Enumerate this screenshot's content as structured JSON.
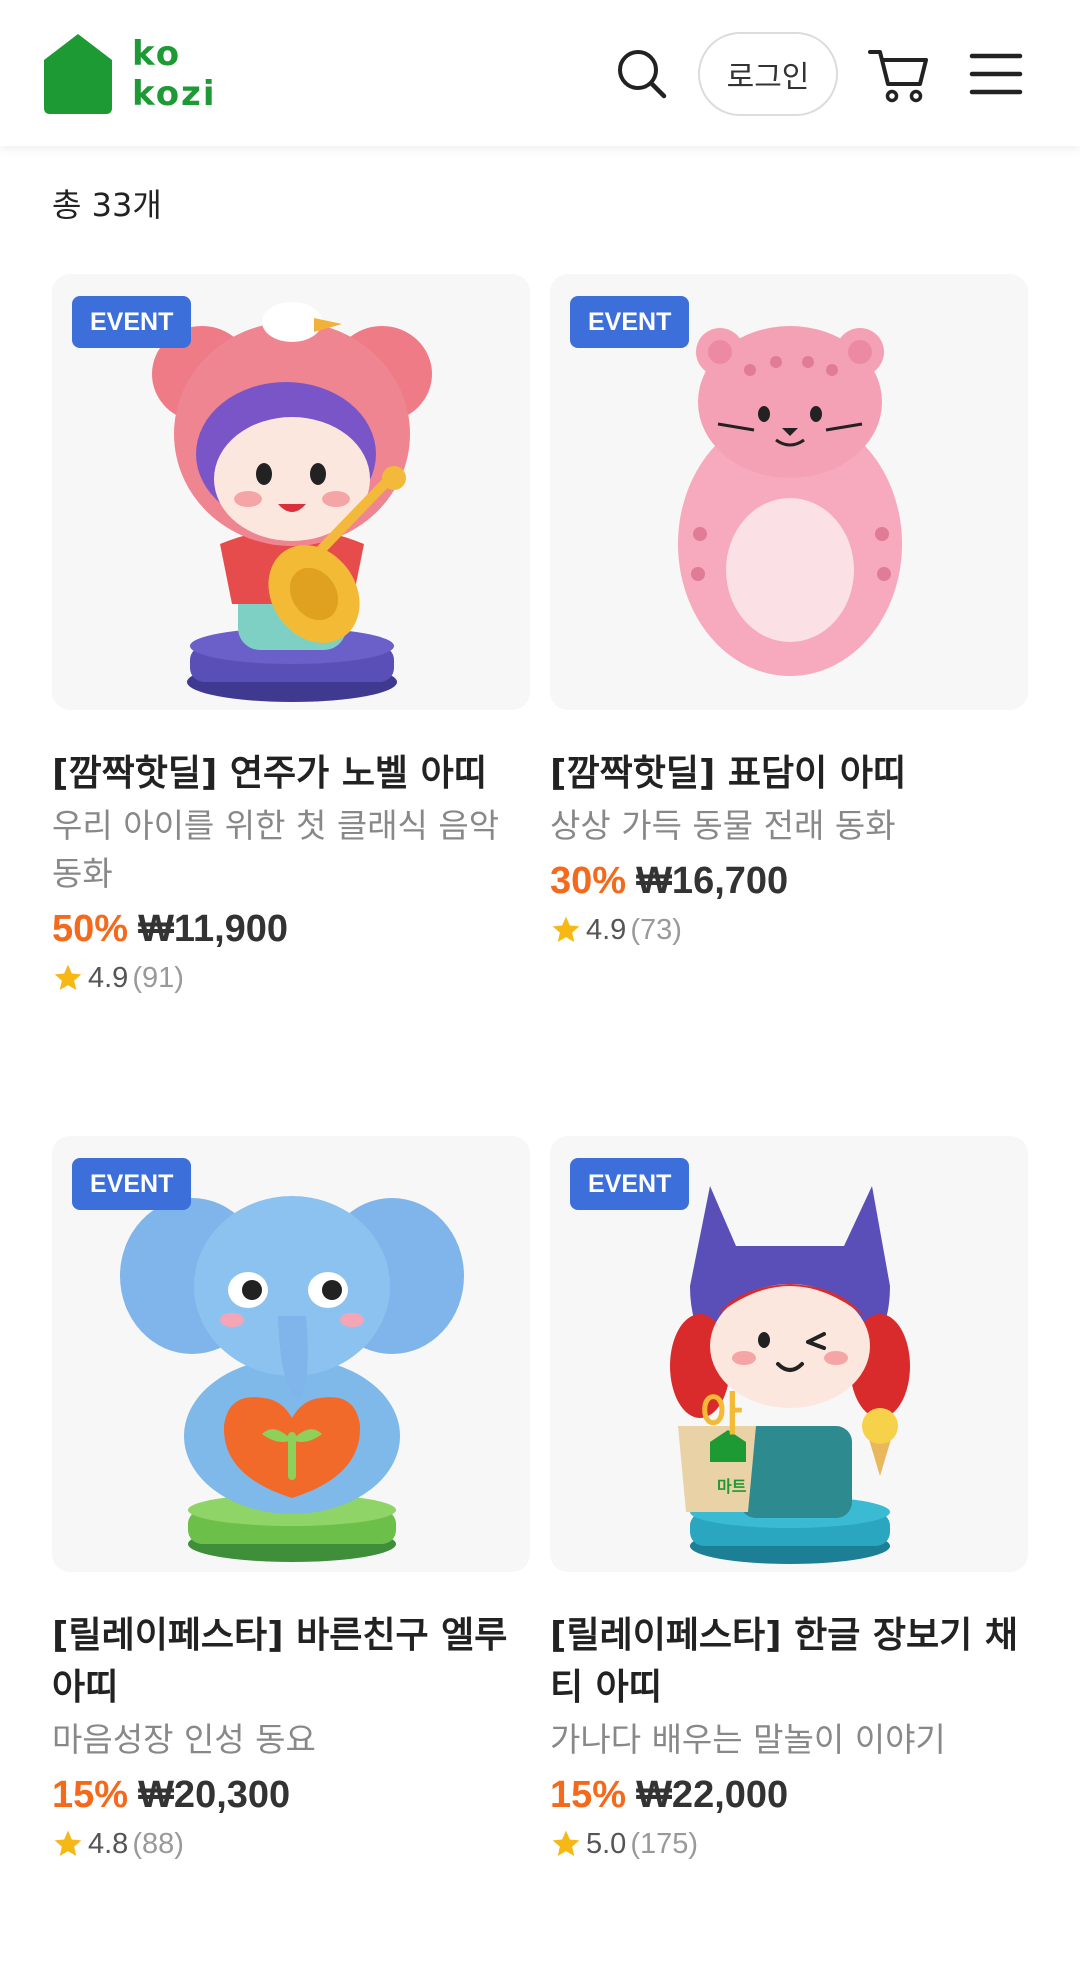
{
  "header": {
    "logo_text_line1": "ko",
    "logo_text_line2": "kozi",
    "login_label": "로그인"
  },
  "icons": {
    "search": "search-icon",
    "cart": "cart-icon",
    "menu": "hamburger-menu-icon",
    "star": "star-icon"
  },
  "colors": {
    "brand_green": "#1e9a34",
    "event_badge": "#3d6fdb",
    "discount": "#f36a1d",
    "star": "#f5b814"
  },
  "list": {
    "total_count": "총 33개"
  },
  "products": [
    {
      "badge": "EVENT",
      "title": "[깜짝핫딜] 연주가 노벨 아띠",
      "description": "우리 아이를 위한 첫 클래식 음악 동화",
      "discount": "50%",
      "price": "₩11,900",
      "rating": "4.9",
      "reviews": "(91)"
    },
    {
      "badge": "EVENT",
      "title": "[깜짝핫딜] 표담이 아띠",
      "description": "상상 가득 동물 전래 동화",
      "discount": "30%",
      "price": "₩16,700",
      "rating": "4.9",
      "reviews": "(73)"
    },
    {
      "badge": "EVENT",
      "title": "[릴레이페스타] 바른친구 엘루 아띠",
      "description": "마음성장 인성 동요",
      "discount": "15%",
      "price": "₩20,300",
      "rating": "4.8",
      "reviews": "(88)"
    },
    {
      "badge": "EVENT",
      "title": "[릴레이페스타] 한글 장보기 채티 아띠",
      "description": "가나다 배우는 말놀이 이야기",
      "discount": "15%",
      "price": "₩22,000",
      "rating": "5.0",
      "reviews": "(175)",
      "figure_sign": "마트",
      "figure_balloon": "아"
    }
  ]
}
